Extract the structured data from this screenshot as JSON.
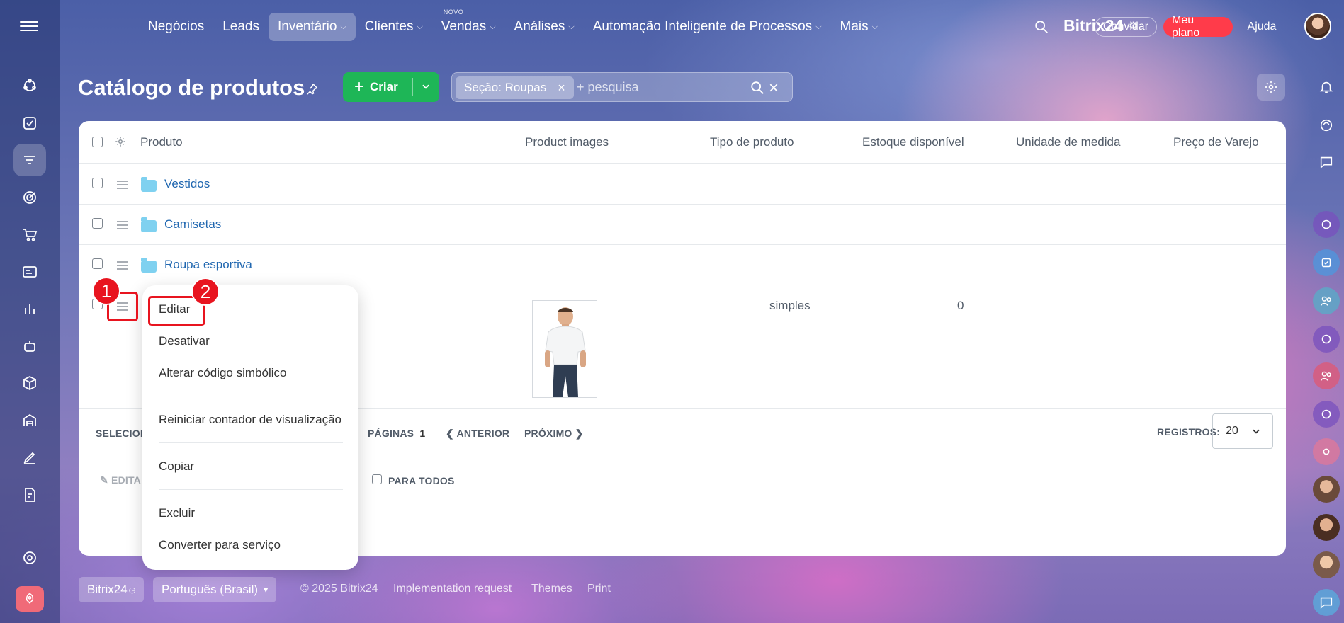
{
  "nav": {
    "items": [
      {
        "label": "Negócios",
        "chevron": false,
        "badge": ""
      },
      {
        "label": "Leads",
        "chevron": false,
        "badge": ""
      },
      {
        "label": "Inventário",
        "chevron": true,
        "badge": "",
        "active": true
      },
      {
        "label": "Clientes",
        "chevron": true,
        "badge": ""
      },
      {
        "label": "Vendas",
        "chevron": true,
        "badge": "NOVO"
      },
      {
        "label": "Análises",
        "chevron": true,
        "badge": ""
      },
      {
        "label": "Automação Inteligente de Processos",
        "chevron": true,
        "badge": ""
      },
      {
        "label": "Mais",
        "chevron": true,
        "badge": ""
      }
    ],
    "brand": "Bitrix24",
    "invite": "Convidar",
    "plan": "Meu plano",
    "help": "Ajuda"
  },
  "page": {
    "title": "Catálogo de produtos",
    "create_label": "Criar",
    "filter_chip": "Seção: Roupas",
    "search_placeholder": "+ pesquisa"
  },
  "table": {
    "columns": [
      "Produto",
      "Product images",
      "Tipo de produto",
      "Estoque disponível",
      "Unidade de medida",
      "Preço de Varejo"
    ],
    "folders": [
      "Vestidos",
      "Camisetas",
      "Roupa esportiva"
    ],
    "product_row": {
      "type": "simples",
      "stock": "0"
    }
  },
  "footer": {
    "selected": "SELECIONA",
    "pages_label": "PÁGINAS",
    "page_number": "1",
    "prev": "ANTERIOR",
    "next": "PRÓXIMO",
    "records_label": "REGISTROS:",
    "records_value": "20",
    "edit_label": "EDITA",
    "for_all": "PARA TODOS"
  },
  "context_menu": {
    "items": [
      "Editar",
      "Desativar",
      "Alterar código simbólico",
      "Reiniciar contador de visualização",
      "Copiar",
      "Excluir",
      "Converter para serviço"
    ]
  },
  "annotations": {
    "one": "1",
    "two": "2"
  },
  "bottom": {
    "bitrix": "Bitrix24",
    "language": "Português (Brasil)",
    "copyright": "© 2025 Bitrix24",
    "implementation": "Implementation request",
    "themes": "Themes",
    "print": "Print"
  },
  "colors": {
    "accent_green": "#1eb657",
    "accent_red": "#ff3b4a",
    "link": "#2067b0",
    "annotation": "#e8141f"
  }
}
